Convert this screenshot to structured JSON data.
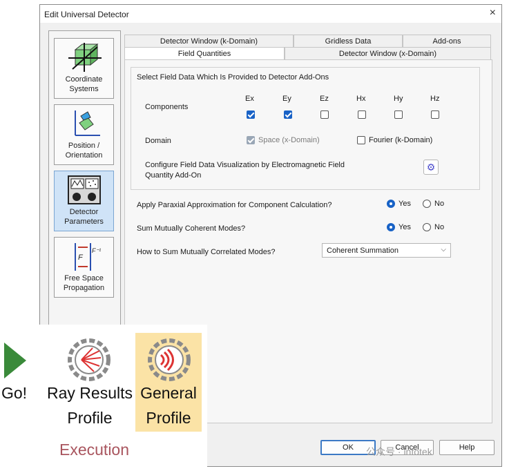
{
  "window": {
    "title": "Edit Universal Detector",
    "close_icon": "×"
  },
  "nav": [
    {
      "label_1": "Coordinate",
      "label_2": "Systems",
      "icon": "coordinate-systems-icon"
    },
    {
      "label_1": "Position /",
      "label_2": "Orientation",
      "icon": "position-orientation-icon"
    },
    {
      "label_1": "Detector",
      "label_2": "Parameters",
      "icon": "detector-parameters-icon",
      "active": true
    },
    {
      "label_1": "Free Space",
      "label_2": "Propagation",
      "icon": "free-space-propagation-icon"
    }
  ],
  "tabs": {
    "row1": [
      "Detector Window (k-Domain)",
      "Gridless Data",
      "Add-ons"
    ],
    "row2": [
      "Field Quantities",
      "Detector Window (x-Domain)"
    ],
    "active": "Field Quantities"
  },
  "field_data": {
    "group_title": "Select Field Data Which Is Provided to Detector Add-Ons",
    "components_label": "Components",
    "components": [
      {
        "name": "Ex",
        "checked": true
      },
      {
        "name": "Ey",
        "checked": true
      },
      {
        "name": "Ez",
        "checked": false
      },
      {
        "name": "Hx",
        "checked": false
      },
      {
        "name": "Hy",
        "checked": false
      },
      {
        "name": "Hz",
        "checked": false
      }
    ],
    "domain_label": "Domain",
    "domain_space": "Space (x-Domain)",
    "domain_fourier": "Fourier (k-Domain)",
    "config_line1": "Configure Field Data Visualization by Electromagnetic Field",
    "config_line2": "Quantity Add-On"
  },
  "options": {
    "paraxial_label": "Apply Paraxial Approximation for Component Calculation?",
    "paraxial_value": "Yes",
    "coherent_label": "Sum Mutually Coherent Modes?",
    "coherent_value": "Yes",
    "yes": "Yes",
    "no": "No",
    "correlated_label": "How to Sum Mutually Correlated Modes?",
    "correlated_value": "Coherent Summation"
  },
  "buttons": {
    "ok": "OK",
    "cancel": "Cancel",
    "help": "Help"
  },
  "ribbon": {
    "go": "Go!",
    "ray_line1": "Ray Results",
    "ray_line2": "Profile",
    "general_line1": "General",
    "general_line2": "Profile",
    "group": "Execution"
  },
  "watermark": "公众号 · infotek",
  "colors": {
    "accent": "#1862c6",
    "highlight": "#fbe3a6",
    "group_label": "#a9555e",
    "go_green": "#3a8a3a"
  }
}
